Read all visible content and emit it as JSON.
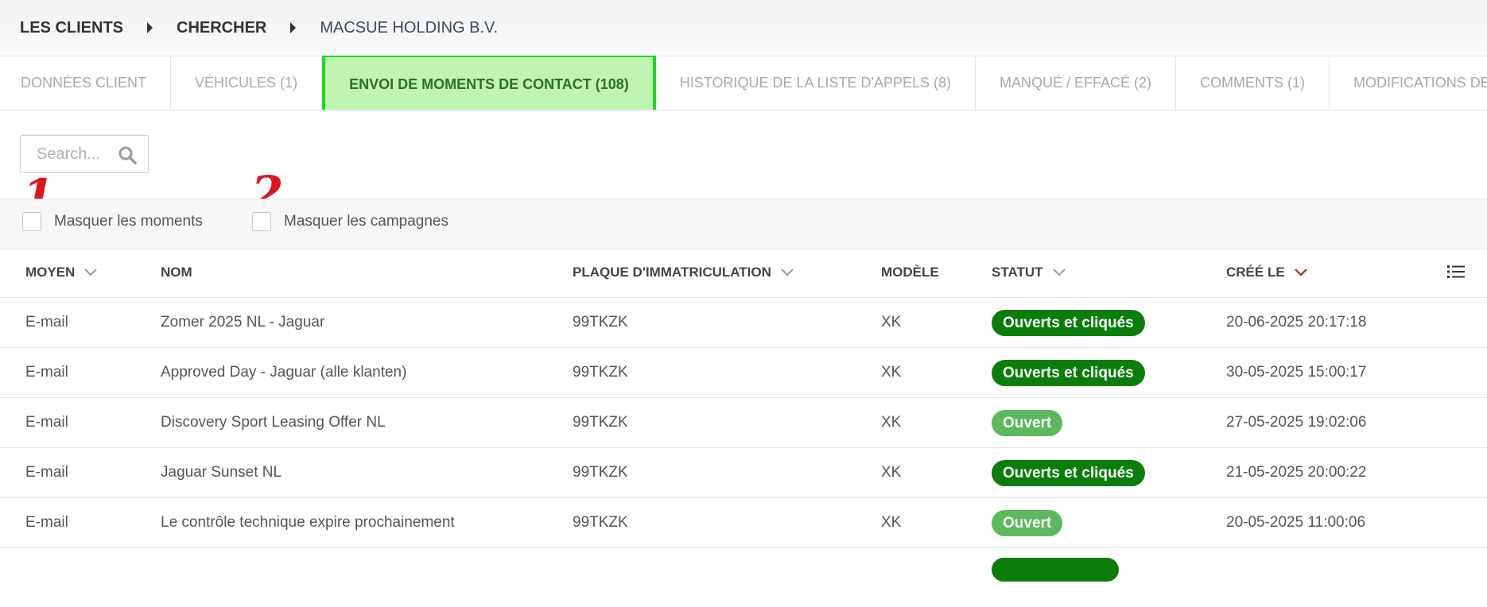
{
  "breadcrumb": {
    "items": [
      "LES CLIENTS",
      "CHERCHER",
      "MACSUE HOLDING B.V."
    ]
  },
  "tabs": [
    {
      "label": "DONNÉES CLIENT",
      "active": false
    },
    {
      "label": "VÉHICULES (1)",
      "active": false
    },
    {
      "label": "ENVOI DE MOMENTS DE CONTACT (108)",
      "active": true
    },
    {
      "label": "HISTORIQUE DE LA LISTE D'APPELS (8)",
      "active": false
    },
    {
      "label": "MANQUÉ / EFFACÉ (2)",
      "active": false
    },
    {
      "label": "COMMENTS (1)",
      "active": false
    },
    {
      "label": "MODIFICATIONS DES DONNÉ",
      "active": false
    }
  ],
  "search": {
    "placeholder": "Search..."
  },
  "filters": {
    "hide_moments": {
      "label": "Masquer les moments",
      "marker": "1",
      "checked": false
    },
    "hide_campaigns": {
      "label": "Masquer les campagnes",
      "marker": "2",
      "checked": false
    }
  },
  "table": {
    "columns": {
      "moyen": "MOYEN",
      "nom": "NOM",
      "plaque": "PLAQUE D'IMMATRICULATION",
      "modele": "MODÈLE",
      "statut": "STATUT",
      "cree_le": "CRÉÉ LE"
    },
    "sorted_column": "cree_le",
    "rows": [
      {
        "moyen": "E-mail",
        "nom": "Zomer 2025 NL - Jaguar",
        "plaque": "99TKZK",
        "modele": "XK",
        "statut": "Ouverts et cliqués",
        "statut_kind": "oc",
        "cree_le": "20-06-2025 20:17:18"
      },
      {
        "moyen": "E-mail",
        "nom": "Approved Day - Jaguar (alle klanten)",
        "plaque": "99TKZK",
        "modele": "XK",
        "statut": "Ouverts et cliqués",
        "statut_kind": "oc",
        "cree_le": "30-05-2025 15:00:17"
      },
      {
        "moyen": "E-mail",
        "nom": "Discovery Sport Leasing Offer NL",
        "plaque": "99TKZK",
        "modele": "XK",
        "statut": "Ouvert",
        "statut_kind": "ouv",
        "cree_le": "27-05-2025 19:02:06"
      },
      {
        "moyen": "E-mail",
        "nom": "Jaguar Sunset NL",
        "plaque": "99TKZK",
        "modele": "XK",
        "statut": "Ouverts et cliqués",
        "statut_kind": "oc",
        "cree_le": "21-05-2025 20:00:22"
      },
      {
        "moyen": "E-mail",
        "nom": "Le contrôle technique expire prochainement",
        "plaque": "99TKZK",
        "modele": "XK",
        "statut": "Ouvert",
        "statut_kind": "ouv",
        "cree_le": "20-05-2025 11:00:06"
      }
    ]
  },
  "colors": {
    "active_tab_bg": "#c0f4b3",
    "active_tab_border": "#1ed81e",
    "badge_opened_clicked": "#0a7d0a",
    "badge_opened": "#5cb85c",
    "annotation_marker": "#e0141e",
    "sort_indicator": "#c0392b"
  },
  "icons": {
    "search": "search-icon",
    "column_settings": "list-icon"
  }
}
